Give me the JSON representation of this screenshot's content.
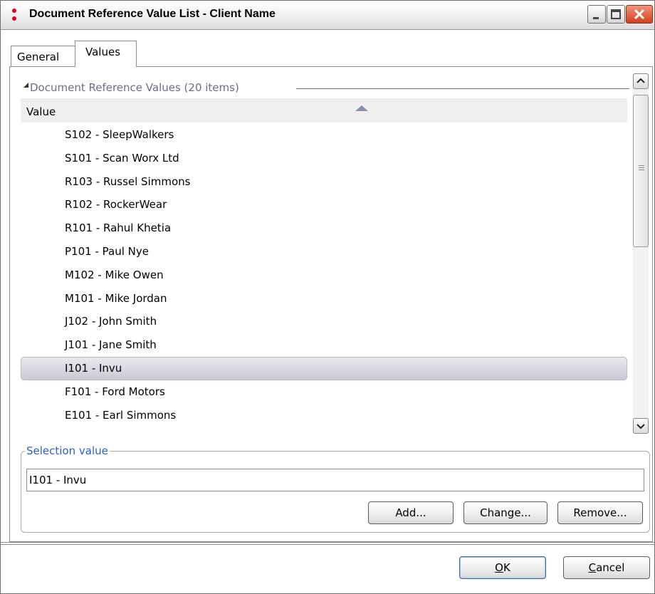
{
  "window": {
    "title": "Document Reference Value List - Client Name"
  },
  "tabs": [
    {
      "label": "General",
      "active": false
    },
    {
      "label": "Values",
      "active": true
    }
  ],
  "list": {
    "group_label": "Document Reference Values (20 items)",
    "column_header": "Value",
    "sort": "ascending-indicator",
    "rows": [
      "S102 - SleepWalkers",
      "S101 - Scan Worx Ltd",
      "R103 - Russel Simmons",
      "R102 - RockerWear",
      "R101 - Rahul Khetia",
      "P101 - Paul Nye",
      "M102 - Mike Owen",
      "M101 - Mike Jordan",
      "J102 - John Smith",
      "J101 - Jane Smith",
      "I101 - Invu",
      "F101 - Ford Motors",
      "E101 - Earl Simmons"
    ],
    "selected_index": 10
  },
  "selection": {
    "legend": "Selection value",
    "value": "I101 - Invu"
  },
  "buttons": {
    "add": "Add...",
    "change": "Change...",
    "remove": "Remove...",
    "ok_underline": "O",
    "ok_rest": "K",
    "cancel_underline": "C",
    "cancel_rest": "ancel"
  },
  "colors": {
    "legend_blue": "#2d5fd2",
    "close_red": "#d2401c",
    "app_icon_red": "#e0001a",
    "group_label": "#6c6c8c"
  }
}
